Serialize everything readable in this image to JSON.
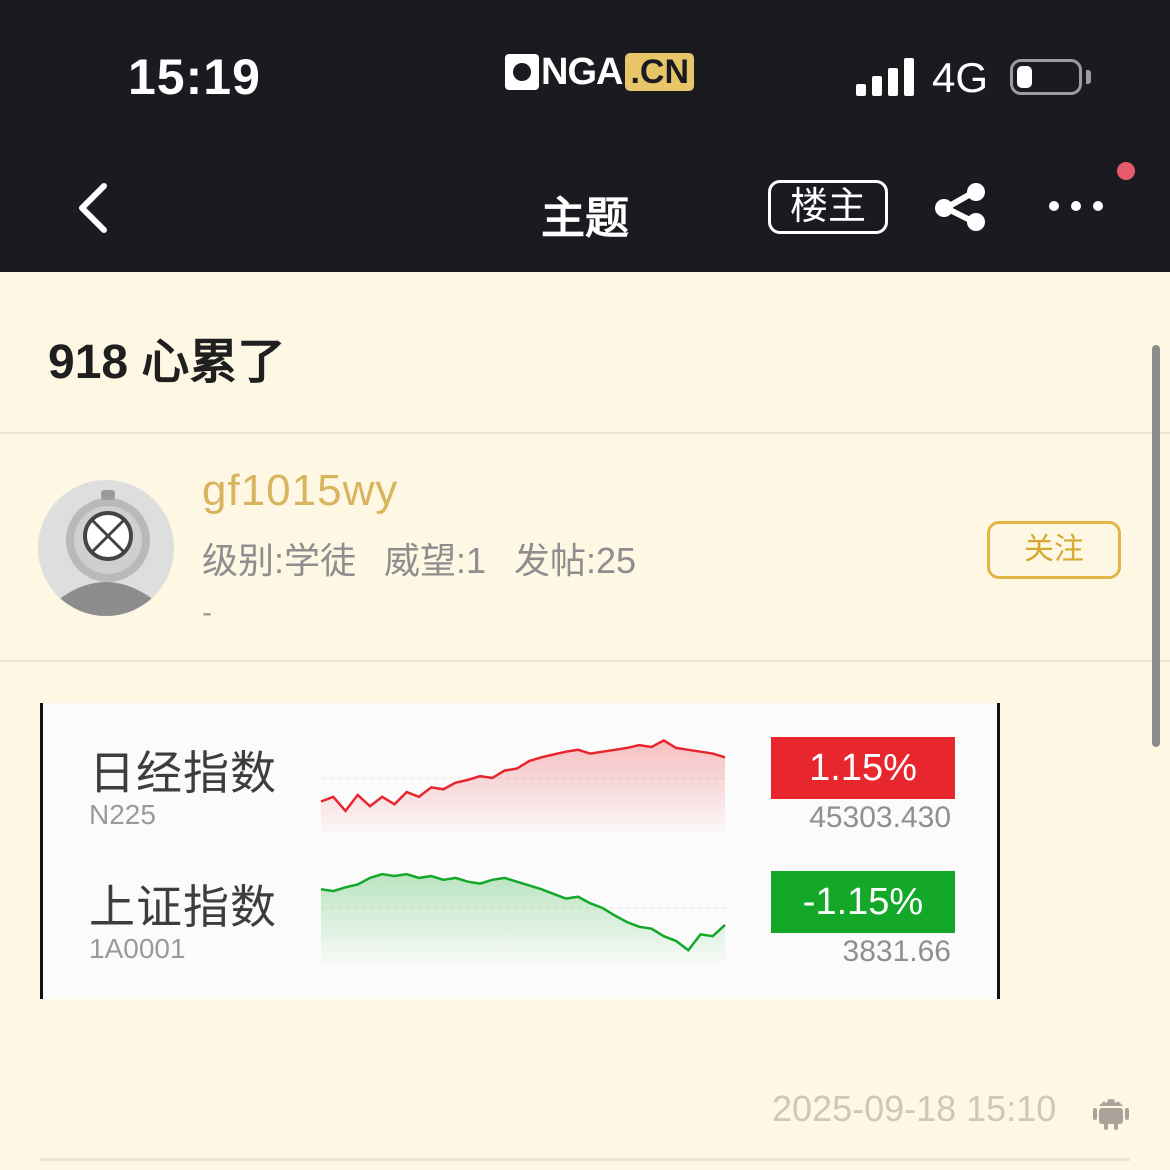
{
  "status_bar": {
    "time": "15:19",
    "logo_main": "NGA",
    "logo_suffix": ".CN",
    "network": "4G",
    "battery_level": 0.25
  },
  "nav": {
    "title": "主题",
    "op_label": "楼主"
  },
  "thread": {
    "title": "918 心累了"
  },
  "author": {
    "name": "gf1015wy",
    "meta": "级别:学徒 威望:1 发帖:25",
    "signature": "-",
    "follow_label": "关注"
  },
  "post_image": {
    "indices": [
      {
        "name": "日经指数",
        "code": "N225",
        "change": "1.15%",
        "value": "45303.430",
        "color": "#e8262d",
        "trend": [
          0.25,
          0.3,
          0.15,
          0.32,
          0.2,
          0.3,
          0.22,
          0.35,
          0.3,
          0.4,
          0.38,
          0.45,
          0.48,
          0.52,
          0.5,
          0.58,
          0.6,
          0.68,
          0.72,
          0.75,
          0.78,
          0.8,
          0.76,
          0.78,
          0.8,
          0.82,
          0.85,
          0.83,
          0.9,
          0.82,
          0.8,
          0.78,
          0.76,
          0.72
        ]
      },
      {
        "name": "上证指数",
        "code": "1A0001",
        "change": "-1.15%",
        "value": "3831.66",
        "color": "#14a829",
        "trend": [
          0.7,
          0.68,
          0.72,
          0.75,
          0.82,
          0.86,
          0.84,
          0.86,
          0.82,
          0.84,
          0.8,
          0.82,
          0.78,
          0.76,
          0.8,
          0.82,
          0.78,
          0.74,
          0.7,
          0.65,
          0.6,
          0.62,
          0.55,
          0.5,
          0.42,
          0.35,
          0.3,
          0.28,
          0.2,
          0.15,
          0.05,
          0.22,
          0.2,
          0.32
        ]
      }
    ]
  },
  "post_meta": {
    "time": "2025-09-18 15:10",
    "device_icon": "android-icon"
  }
}
